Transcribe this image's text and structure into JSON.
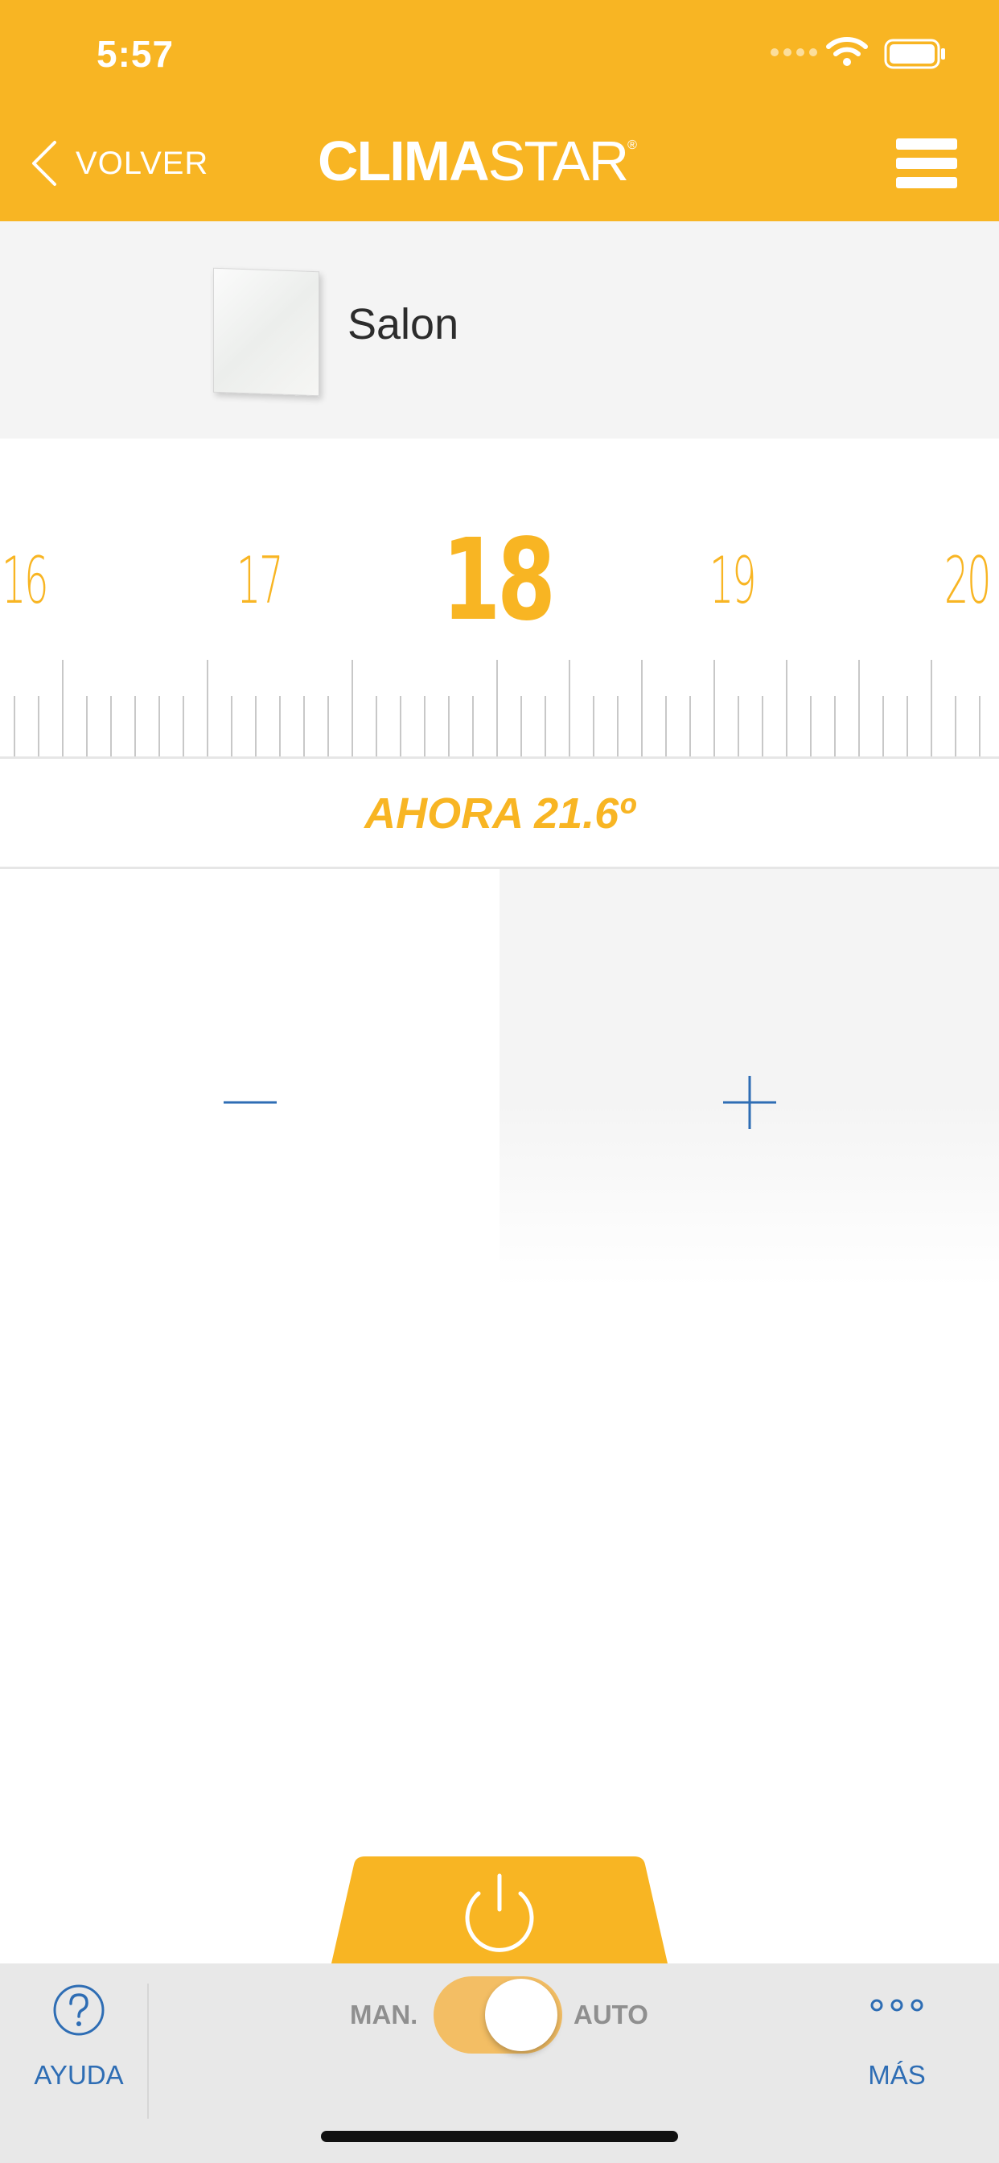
{
  "status_bar": {
    "time": "5:57"
  },
  "header": {
    "back_label": "VOLVER",
    "logo_bold": "CLIMA",
    "logo_light": "STAR",
    "logo_mark": "®",
    "accent_color": "#F8B523"
  },
  "device": {
    "name": "Salon"
  },
  "thermostat": {
    "scale": [
      "16",
      "17",
      "18",
      "19",
      "20"
    ],
    "selected": "18",
    "current_text": "AHORA 21.6º"
  },
  "controls": {
    "decrease_icon": "minus-icon",
    "increase_icon": "plus-icon"
  },
  "power": {
    "icon": "power-icon"
  },
  "bottom_bar": {
    "help_label": "AYUDA",
    "mode_manual_label": "MAN.",
    "mode_auto_label": "AUTO",
    "more_label": "MÁS",
    "link_color": "#2E6DB4"
  }
}
